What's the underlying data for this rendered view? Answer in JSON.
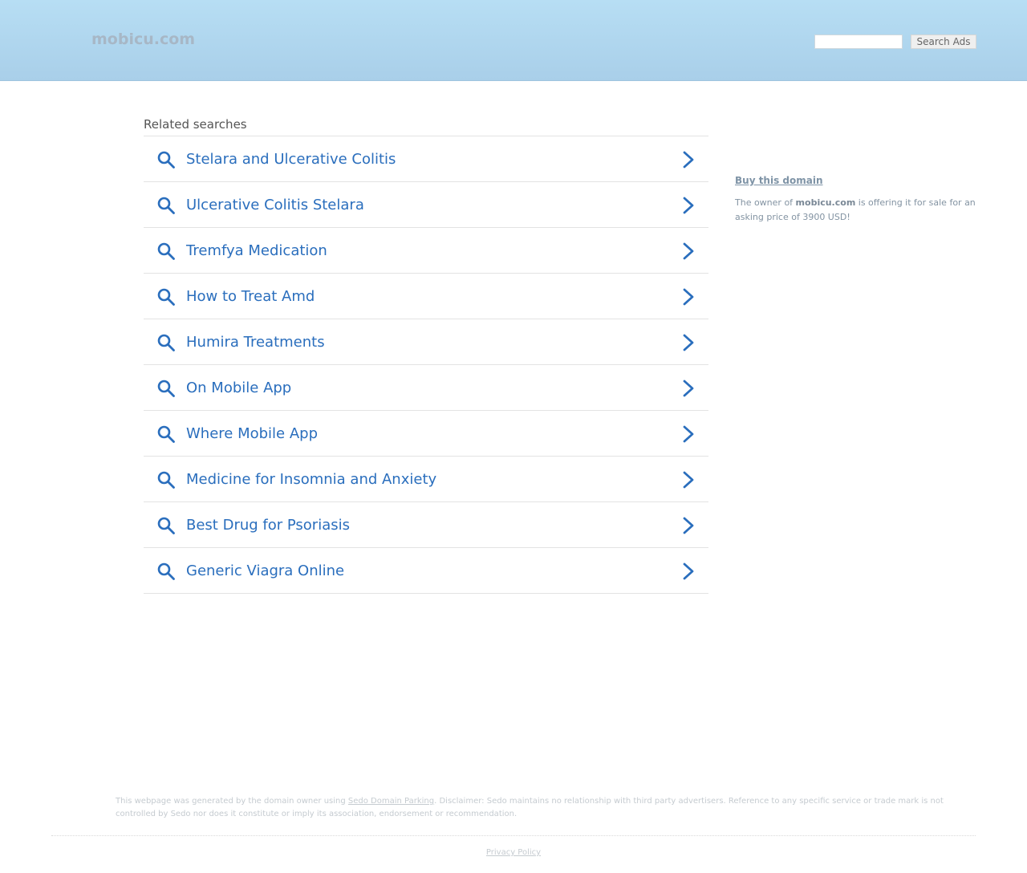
{
  "header": {
    "logo": "mobicu.com",
    "search_placeholder": "",
    "search_button": "Search Ads"
  },
  "related": {
    "title": "Related searches",
    "items": [
      {
        "label": "Stelara and Ulcerative Colitis"
      },
      {
        "label": "Ulcerative Colitis Stelara"
      },
      {
        "label": "Tremfya Medication"
      },
      {
        "label": "How to Treat Amd"
      },
      {
        "label": "Humira Treatments"
      },
      {
        "label": "On Mobile App"
      },
      {
        "label": "Where Mobile App"
      },
      {
        "label": "Medicine for Insomnia and Anxiety"
      },
      {
        "label": "Best Drug for Psoriasis"
      },
      {
        "label": "Generic Viagra Online"
      }
    ],
    "icons": {
      "search": "search-icon",
      "arrow": "chevron-right-icon"
    },
    "colors": {
      "link": "#2a6ebd"
    }
  },
  "sidebar": {
    "buy_link": "Buy this domain",
    "owner_prefix": "The owner of ",
    "owner_domain": "mobicu.com",
    "owner_suffix": " is offering it for sale for an asking price of 3900 USD!"
  },
  "footer": {
    "disclaimer_prefix": "This webpage was generated by the domain owner using ",
    "disclaimer_link": "Sedo Domain Parking",
    "disclaimer_suffix": ". Disclaimer: Sedo maintains no relationship with third party advertisers. Reference to any specific service or trade mark is not controlled by Sedo nor does it constitute or imply its association, endorsement or recommendation.",
    "privacy": "Privacy Policy"
  }
}
